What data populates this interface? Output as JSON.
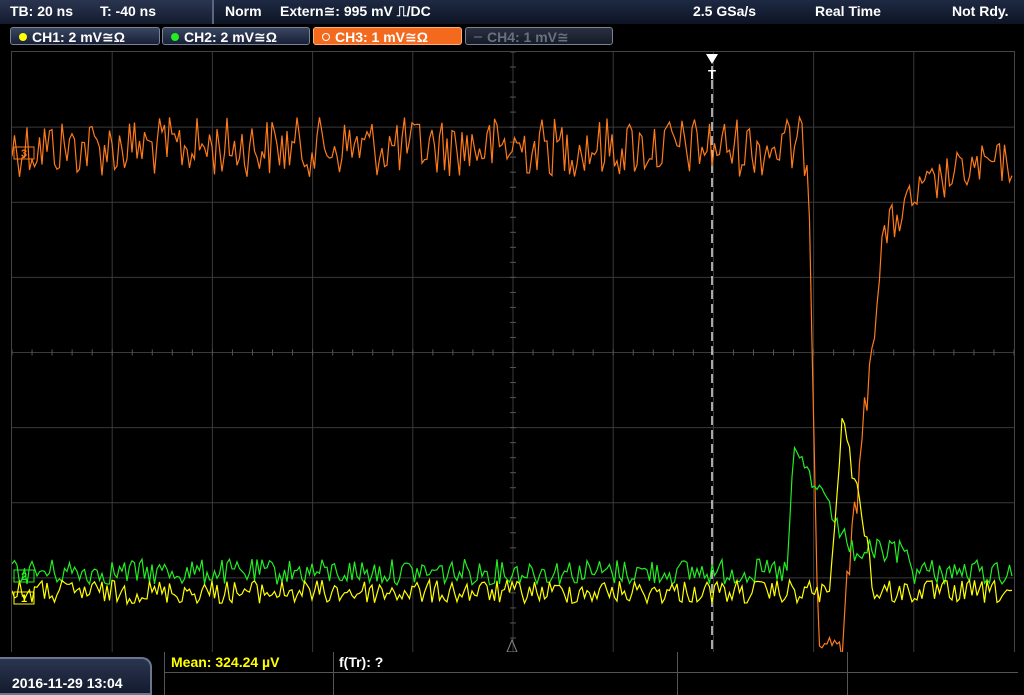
{
  "status": {
    "timebase": "TB: 20 ns",
    "trigger_offset": "T: -40 ns",
    "trigger_mode": "Norm",
    "trigger_source": "Extern≅: 995 mV ⎍/DC",
    "sample_rate": "2.5 GSa/s",
    "acq_mode": "Real Time",
    "acq_state": "Not Rdy."
  },
  "channels": [
    {
      "label": "CH1: 2 mV≅Ω",
      "color": "#ffff00",
      "state": "on"
    },
    {
      "label": "CH2: 2 mV≅Ω",
      "color": "#22ee22",
      "state": "on"
    },
    {
      "label": "CH3: 1 mV≅Ω",
      "color": "#ff7a1a",
      "state": "selected"
    },
    {
      "label": "CH4: 1 mV≅",
      "color": "#6a7080",
      "state": "off"
    }
  ],
  "markers": {
    "trigger": "T",
    "ch3": "3",
    "ch2": "2",
    "ch1": "1"
  },
  "footer": {
    "datetime": "2016-11-29 13:04",
    "mean_label": "Mean: 324.24 µV",
    "freq_label": "f(Tr): ?"
  },
  "colors": {
    "ch1": "#ffff00",
    "ch2": "#22ee22",
    "ch3": "#ff7a1a",
    "grid": "#3a3a3a",
    "accent": "#f36a1e"
  }
}
